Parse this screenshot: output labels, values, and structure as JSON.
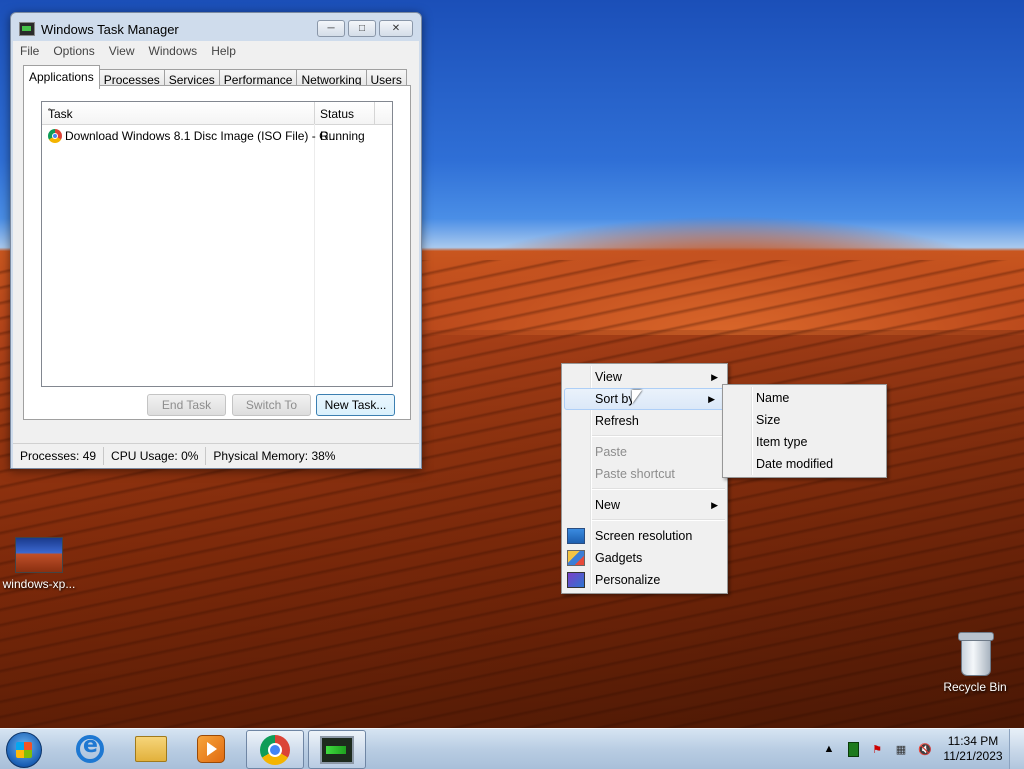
{
  "desktop": {
    "icons": [
      {
        "label": "windows-xp...",
        "icon": "image-thumbnail-icon"
      },
      {
        "label": "Recycle Bin",
        "icon": "recycle-bin-icon"
      }
    ]
  },
  "task_manager": {
    "title": "Windows Task Manager",
    "menu": [
      "File",
      "Options",
      "View",
      "Windows",
      "Help"
    ],
    "tabs": [
      "Applications",
      "Processes",
      "Services",
      "Performance",
      "Networking",
      "Users"
    ],
    "active_tab": "Applications",
    "columns": {
      "task": "Task",
      "status": "Status"
    },
    "rows": [
      {
        "task": "Download Windows 8.1 Disc Image (ISO File) - G...",
        "status": "Running",
        "icon": "chrome-icon"
      }
    ],
    "buttons": {
      "end_task": "End Task",
      "switch_to": "Switch To",
      "new_task": "New Task..."
    },
    "statusbar": {
      "processes": "Processes: 49",
      "cpu": "CPU Usage: 0%",
      "memory": "Physical Memory: 38%"
    }
  },
  "context_menu": {
    "items": [
      {
        "label": "View",
        "submenu": true
      },
      {
        "label": "Sort by",
        "submenu": true,
        "highlighted": true
      },
      {
        "label": "Refresh"
      },
      {
        "label": "Paste",
        "disabled": true
      },
      {
        "label": "Paste shortcut",
        "disabled": true
      },
      {
        "label": "New",
        "submenu": true
      },
      {
        "label": "Screen resolution",
        "icon": "screen-resolution-icon"
      },
      {
        "label": "Gadgets",
        "icon": "gadgets-icon"
      },
      {
        "label": "Personalize",
        "icon": "personalize-icon"
      }
    ],
    "sort_submenu": [
      "Name",
      "Size",
      "Item type",
      "Date modified"
    ]
  },
  "taskbar": {
    "pinned": [
      "internet-explorer-icon",
      "explorer-folder-icon",
      "media-player-icon",
      "chrome-icon",
      "task-manager-icon"
    ],
    "clock_time": "11:34 PM",
    "clock_date": "11/21/2023"
  }
}
